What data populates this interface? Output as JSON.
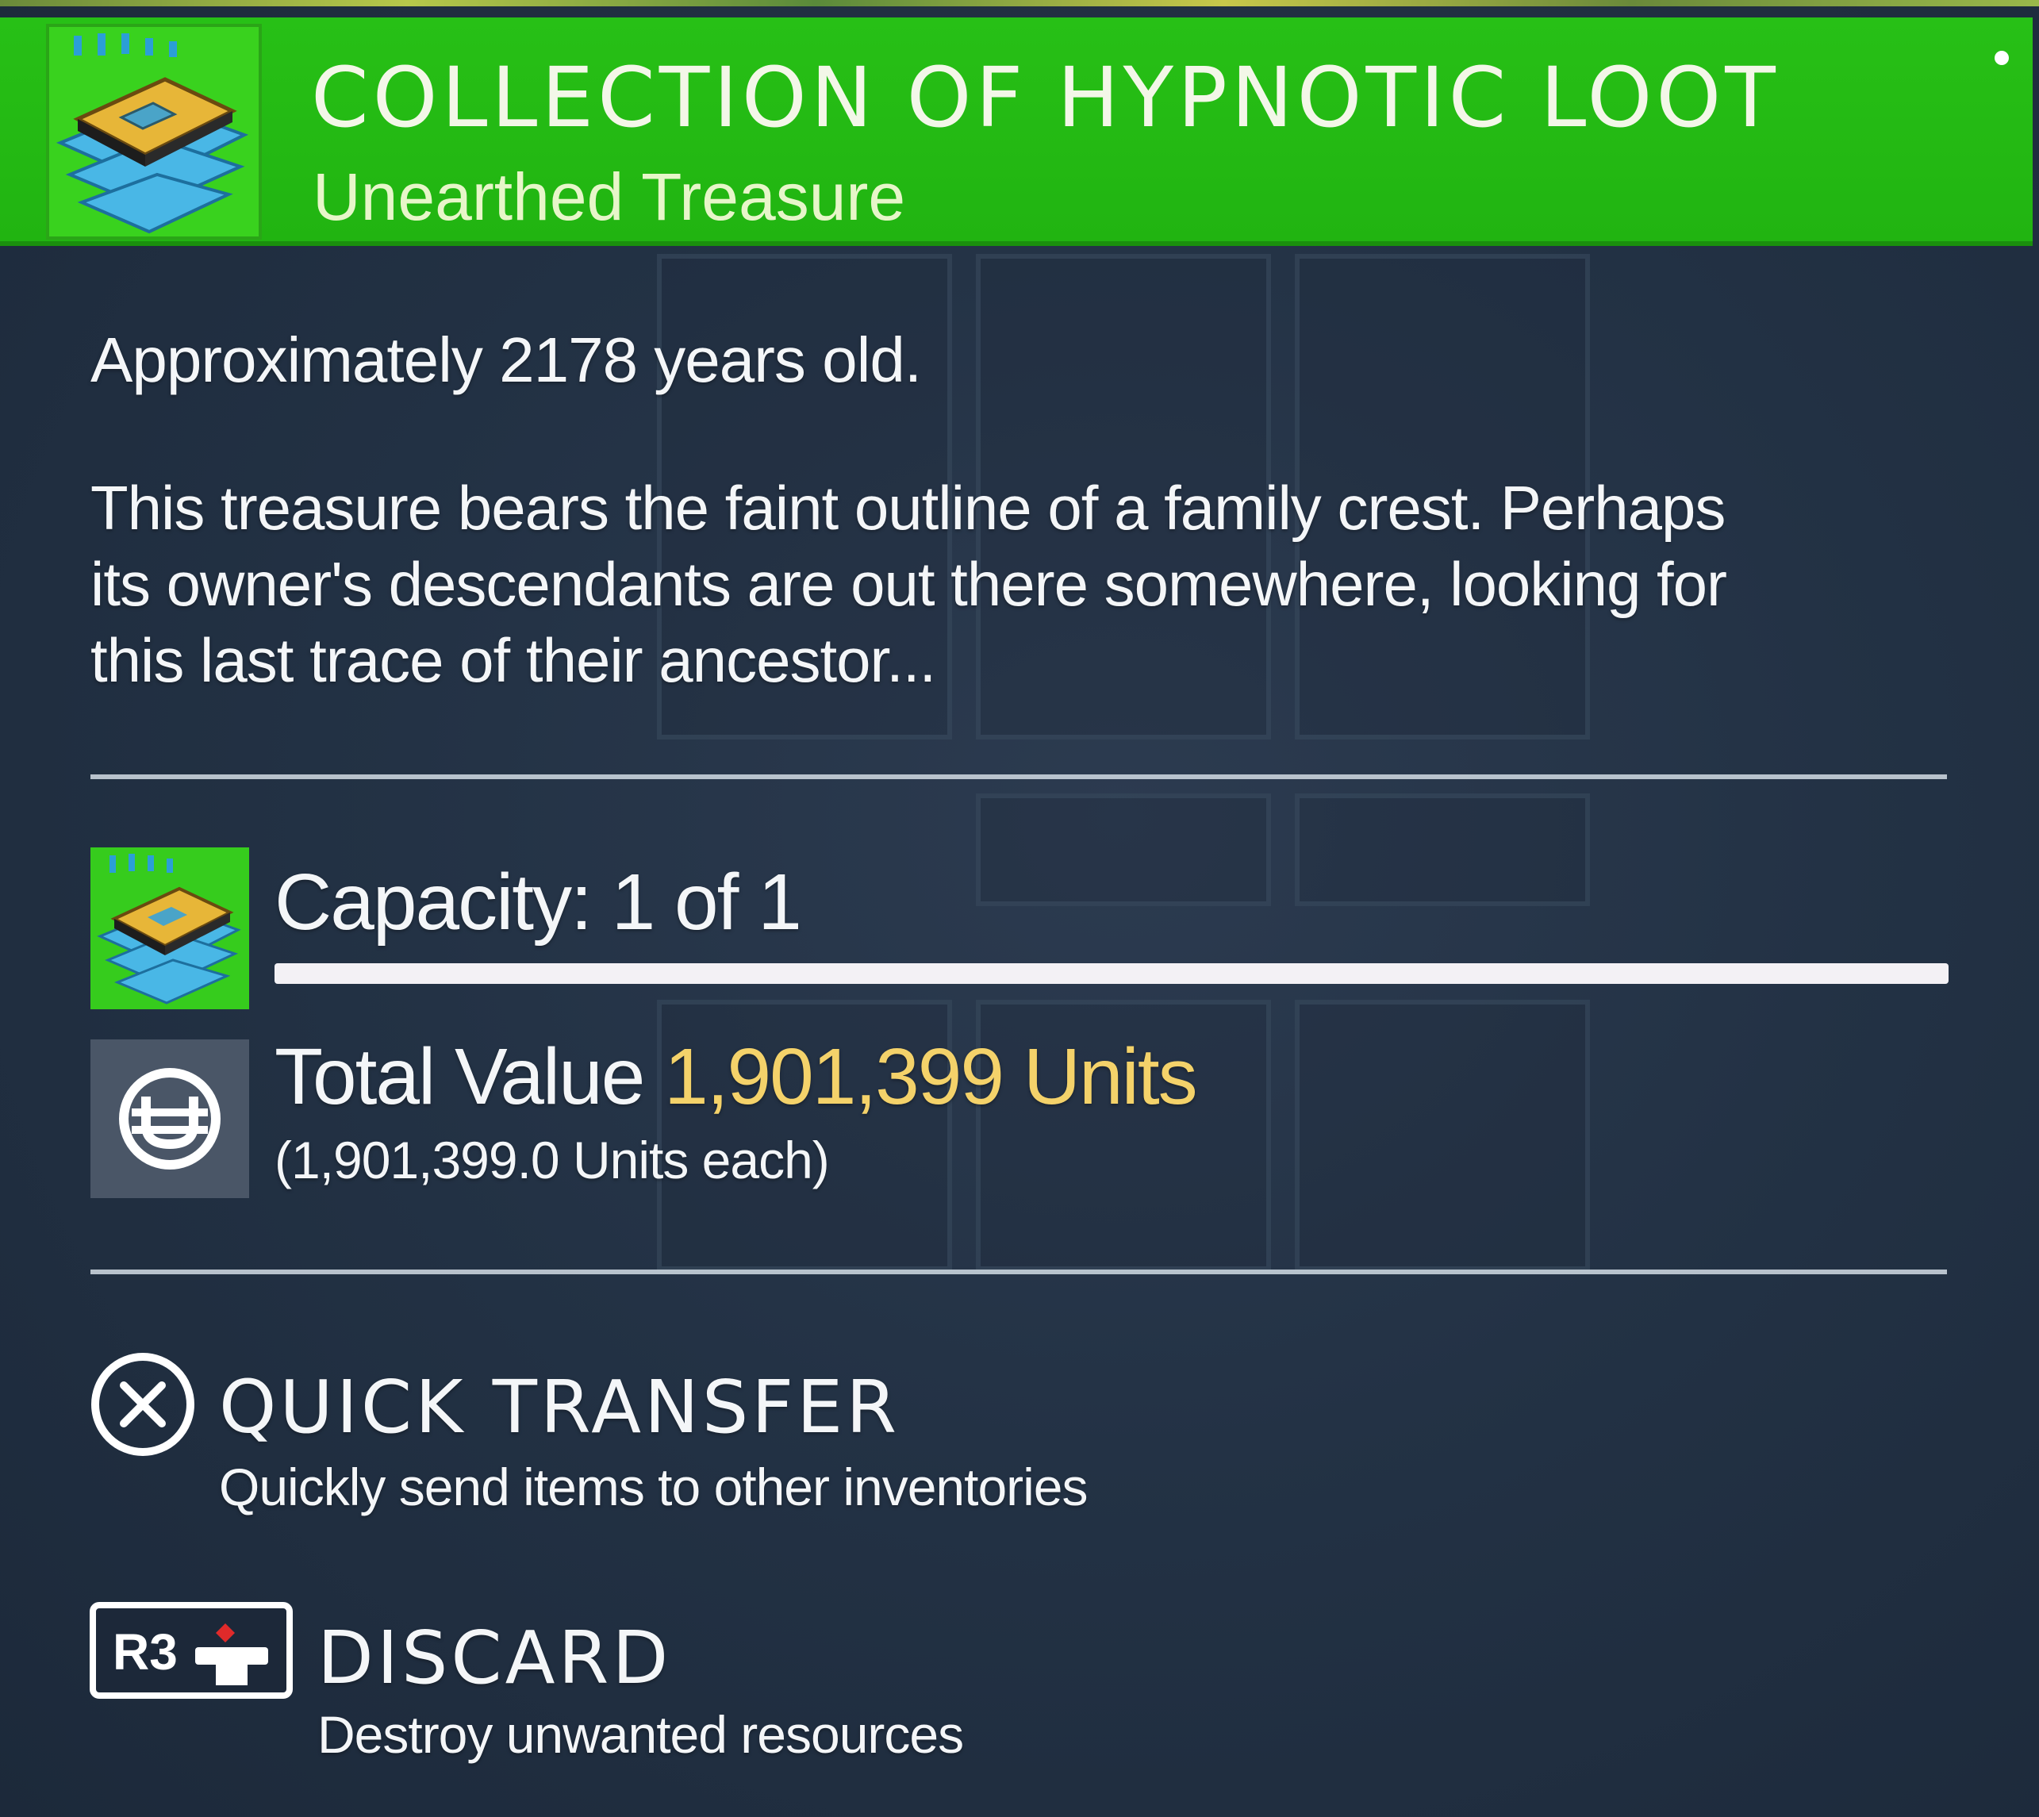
{
  "item": {
    "name": "COLLECTION OF HYPNOTIC LOOT",
    "category": "Unearthed Treasure",
    "age": "Approximately 2178 years old.",
    "description_lines": [
      "This treasure bears the faint outline of a family crest. Perhaps",
      "its owner's descendants are out there somewhere, looking for",
      "this last trace of their ancestor..."
    ],
    "icon": "treasure-stack-icon"
  },
  "capacity": {
    "label": "Capacity: 1 of 1",
    "current": 1,
    "max": 1,
    "fill_fraction": 1.0
  },
  "value": {
    "prefix": "Total Value",
    "amount": "1,901,399 Units",
    "each": "(1,901,399.0 Units each)",
    "icon": "units-currency-icon"
  },
  "actions": {
    "quick_transfer": {
      "title": "QUICK TRANSFER",
      "description": "Quickly send items to other inventories",
      "button_icon": "cross-button-icon"
    },
    "discard": {
      "title": "DISCARD",
      "description": "Destroy unwanted resources",
      "button_label": "R3",
      "button_icon": "r3-button-icon"
    }
  },
  "colors": {
    "header_green": "#23b812",
    "panel_bg": "#243346",
    "value_gold": "#f4d26a",
    "text_white": "#f4f6f8"
  }
}
